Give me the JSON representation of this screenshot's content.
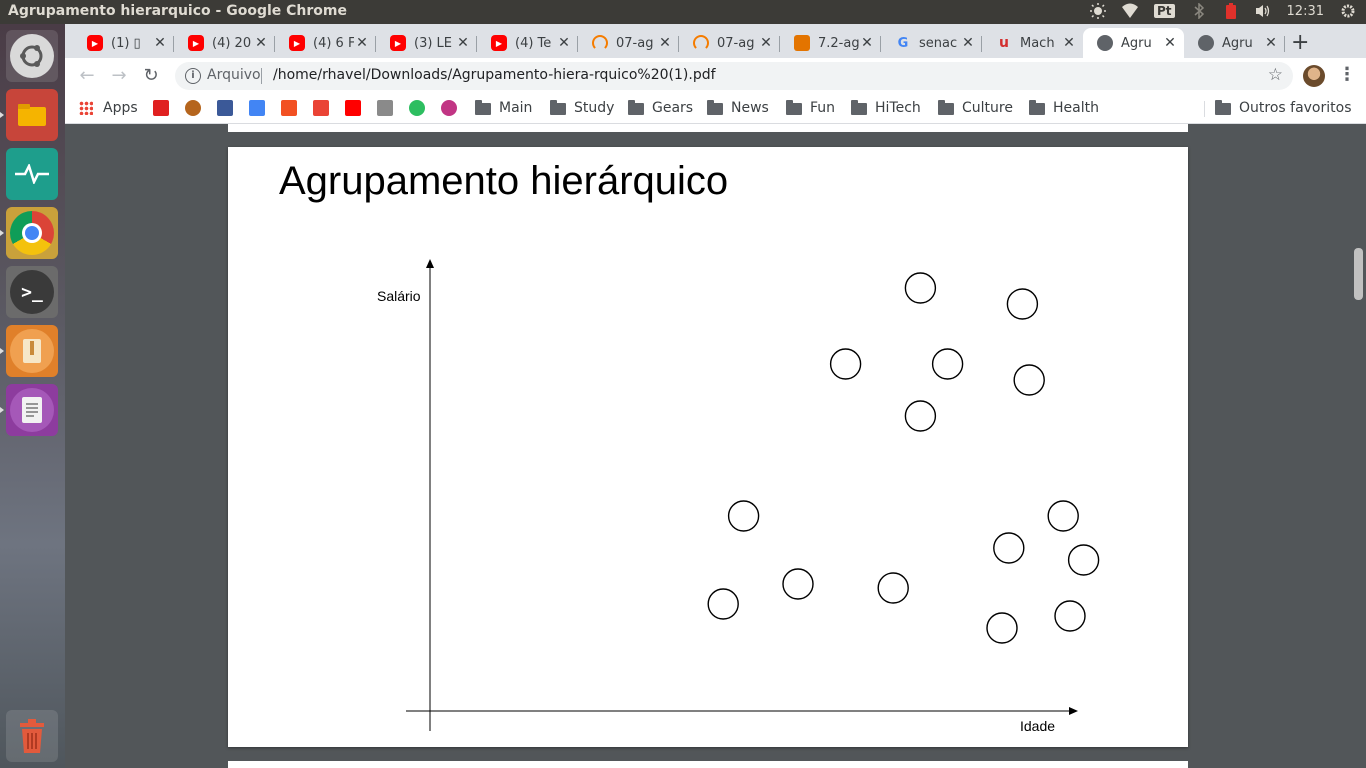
{
  "window_title": "Agrupamento hierarquico - Google Chrome",
  "tray": {
    "lang": "Pt",
    "clock": "12:31"
  },
  "launcher": [
    "ubuntu-dash",
    "files",
    "system-monitor",
    "chrome",
    "terminal",
    "archive-manager",
    "text-editor",
    "trash"
  ],
  "tabs": [
    {
      "label": "(1) ▯",
      "favicon": "youtube-icon",
      "color": "#ff0000"
    },
    {
      "label": "(4) 20",
      "favicon": "youtube-icon",
      "color": "#ff0000"
    },
    {
      "label": "(4) 6 F",
      "favicon": "youtube-icon",
      "color": "#ff0000"
    },
    {
      "label": "(3) LE",
      "favicon": "youtube-icon",
      "color": "#ff0000"
    },
    {
      "label": "(4) Te",
      "favicon": "youtube-icon",
      "color": "#ff0000"
    },
    {
      "label": "07-ag",
      "favicon": "loading-icon",
      "color": "#f57c00"
    },
    {
      "label": "07-ag",
      "favicon": "loading-icon",
      "color": "#f57c00"
    },
    {
      "label": "7.2-ag",
      "favicon": "book-icon",
      "color": "#e37400"
    },
    {
      "label": "senac",
      "favicon": "google-icon",
      "color": "#4285f4"
    },
    {
      "label": "Mach",
      "favicon": "brand-icon",
      "color": "#d32f2f"
    },
    {
      "label": "Agru",
      "favicon": "globe-icon",
      "color": "#5f6368",
      "active": true
    },
    {
      "label": "Agru",
      "favicon": "globe-icon",
      "color": "#5f6368"
    }
  ],
  "omnibox": {
    "scheme": "Arquivo",
    "url": "/home/rhavel/Downloads/Agrupamento-hiera-rquico%20(1).pdf"
  },
  "bookmarks": {
    "apps": "Apps",
    "folders": [
      "Main",
      "Study",
      "Gears",
      "News",
      "Fun",
      "HiTech",
      "Culture",
      "Health"
    ],
    "other": "Outros favoritos"
  },
  "slide": {
    "title": "Agrupamento hierárquico",
    "chart_data": {
      "type": "scatter",
      "xlabel": "Idade",
      "ylabel": "Salário",
      "grid": false,
      "points": [
        {
          "x": 32,
          "y": 28
        },
        {
          "x": 29,
          "y": 6
        },
        {
          "x": 40,
          "y": 11
        },
        {
          "x": 54,
          "y": 10
        },
        {
          "x": 58,
          "y": 85
        },
        {
          "x": 73,
          "y": 81
        },
        {
          "x": 47,
          "y": 66
        },
        {
          "x": 62,
          "y": 66
        },
        {
          "x": 74,
          "y": 62
        },
        {
          "x": 58,
          "y": 53
        },
        {
          "x": 79,
          "y": 28
        },
        {
          "x": 71,
          "y": 20
        },
        {
          "x": 82,
          "y": 17
        },
        {
          "x": 80,
          "y": 3
        },
        {
          "x": 70,
          "y": 0
        }
      ]
    }
  }
}
